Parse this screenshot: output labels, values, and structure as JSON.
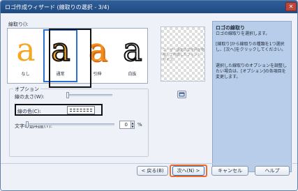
{
  "window": {
    "title": "ロゴ作成ウィザード (線取りの選択 - 3/4)",
    "close_label": "✕"
  },
  "styles": {
    "label": "線取り():",
    "tiles": [
      {
        "glyph": "a",
        "name": "なし"
      },
      {
        "glyph": "a",
        "name": "通常"
      },
      {
        "glyph": "a",
        "name": "引伸"
      },
      {
        "glyph": "a",
        "name": "白抜"
      }
    ],
    "selected_index": 1
  },
  "preview": {
    "text": "ユーザー設定の文字列を使用して作成したフォント サイズ",
    "button_icon": "preview-window-icon"
  },
  "options": {
    "legend": "オプション",
    "thickness_label": "線の太さ(W):",
    "color_label": "線の色(C):",
    "transparency_label": "文字の透明度(T):",
    "transparency_value": "0",
    "transparency_unit": "%"
  },
  "help": {
    "title": "ロゴの線取り",
    "line1": "ロゴの線取りを選択します。",
    "line2": "[線取り]から線取りの種類を1つ選択し、[次へ]をクリックしてください。",
    "line3": "選択した線取りのオプションを調整したい場合は、[オプション]の各項目を変更します。"
  },
  "buttons": {
    "back": "< 戻る(B)",
    "next": "次へ(N) >",
    "cancel": "キャンセル",
    "help": "ヘルプ"
  },
  "colors": {
    "titlebar": "#2f5e98",
    "help_panel": "#b8cde9",
    "logo_orange": "#f5a623",
    "logo_black": "#111111",
    "highlight_frame": "#111111",
    "next_highlight": "#f06a2a"
  }
}
